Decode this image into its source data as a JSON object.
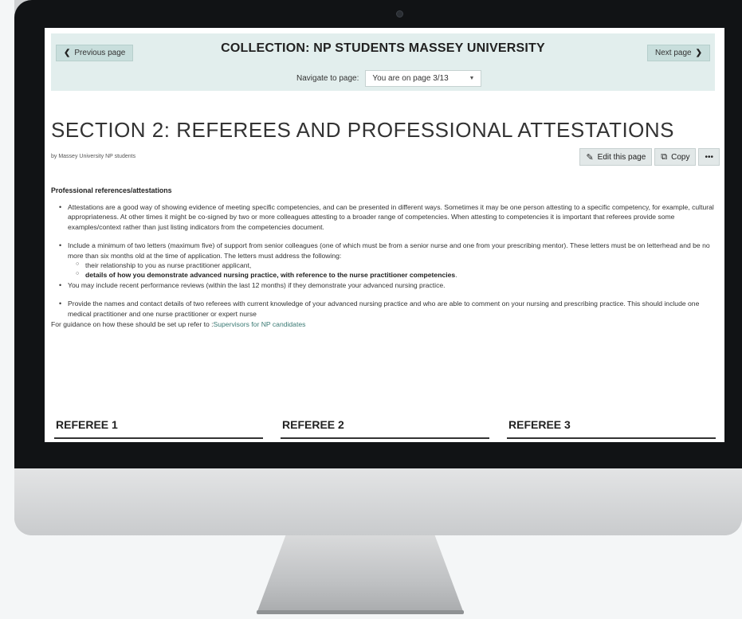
{
  "nav": {
    "prev_label": "Previous page",
    "next_label": "Next page",
    "collection_title": "COLLECTION: NP STUDENTS MASSEY UNIVERSITY",
    "navigate_label": "Navigate to page:",
    "page_select_value": "You are on page 3/13"
  },
  "page": {
    "title": "SECTION 2: REFEREES AND PROFESSIONAL ATTESTATIONS",
    "byline": "by Massey University NP students"
  },
  "actions": {
    "edit_label": "Edit this page",
    "copy_label": "Copy",
    "more_label": "•••"
  },
  "content": {
    "heading": "Professional references/attestations",
    "bullet1": "Attestations are a good way of showing evidence of meeting specific competencies, and can be presented in different ways. Sometimes it may be one person attesting to a specific competency, for example, cultural appropriateness. At other times it might be co-signed by two or more colleagues attesting to a broader range of competencies. When attesting to competencies it is important that referees provide some examples/context rather than just listing indicators from the competencies document.",
    "bullet2": "Include a minimum of two letters (maximum five) of support from senior colleagues (one of which must be from a senior nurse and one from your prescribing mentor). These letters must be on letterhead and be no more than six months old at the time of application. The letters must address the following:",
    "sub1": "their relationship to you as nurse practitioner applicant,",
    "sub2": "details of how you demonstrate advanced nursing practice, with reference to the nurse practitioner competencies",
    "sub2_end": ".",
    "bullet3": "You may include recent performance reviews (within the last 12 months) if they demonstrate your advanced nursing practice.",
    "bullet4": "Provide the names and contact details of two referees with current knowledge of your advanced nursing practice and who are able to comment on your nursing and prescribing practice. This should include one medical practitioner and one nurse practitioner or expert nurse",
    "guidance_prefix": "For guidance on how these should be set up refer to :",
    "guidance_link": "Supervisors for NP candidates"
  },
  "referees": [
    "REFEREE 1",
    "REFEREE 2",
    "REFEREE 3"
  ],
  "colors": {
    "nav_bg": "#e2eeed",
    "link": "#3a7a74",
    "bezel": "#111315"
  }
}
